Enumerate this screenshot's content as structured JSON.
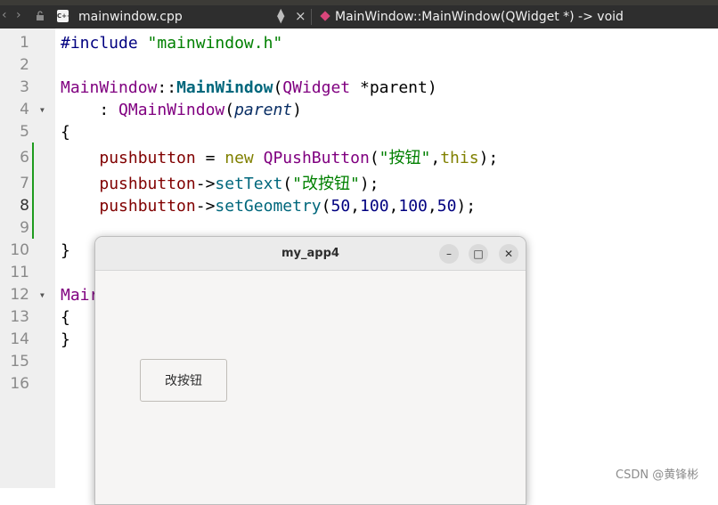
{
  "toolbar": {
    "back_icon": "chevron-left-icon",
    "forward_icon": "chevron-right-icon",
    "file_name": "mainwindow.cpp",
    "file_icon_label": "C++",
    "method": "MainWindow::MainWindow(QWidget *) -> void"
  },
  "editor": {
    "line_numbers": [
      "1",
      "2",
      "3",
      "4",
      "5",
      "6",
      "7",
      "8",
      "9",
      "10",
      "11",
      "12",
      "13",
      "14",
      "15",
      "16"
    ],
    "line1": {
      "directive": "#include",
      "header": "\"mainwindow.h\""
    },
    "line3": {
      "cls": "MainWindow",
      "sep": "::",
      "fn": "MainWindow",
      "open": "(",
      "type": "QWidget",
      "ptr": " *parent",
      "close": ")"
    },
    "line4": {
      "colon": "    : ",
      "base": "QMainWindow",
      "open": "(",
      "arg": "parent",
      "close": ")"
    },
    "line5": {
      "brace": "{"
    },
    "line6": {
      "var": "pushbutton",
      "eq": " = ",
      "new": "new",
      "cls": "QPushButton",
      "open": "(",
      "str": "\"按钮\"",
      "comma": ",",
      "this": "this",
      "end": ");"
    },
    "line7": {
      "var": "pushbutton",
      "arrow": "->",
      "fn": "setText",
      "open": "(",
      "str": "\"改按钮\"",
      "end": ");"
    },
    "line8": {
      "var": "pushbutton",
      "arrow": "->",
      "fn": "setGeometry",
      "open": "(",
      "n1": "50",
      "c1": ",",
      "n2": "100",
      "c2": ",",
      "n3": "100",
      "c3": ",",
      "n4": "50",
      "end": ");"
    },
    "line10": {
      "brace": "}"
    },
    "line12": {
      "text": "Mair"
    },
    "line13": {
      "brace": "{"
    },
    "line14": {
      "brace": "}"
    }
  },
  "app_window": {
    "title": "my_app4",
    "minimize_glyph": "–",
    "maximize_glyph": "□",
    "close_glyph": "✕",
    "button_label": "改按钮"
  },
  "watermark": "CSDN @黄锋彬"
}
